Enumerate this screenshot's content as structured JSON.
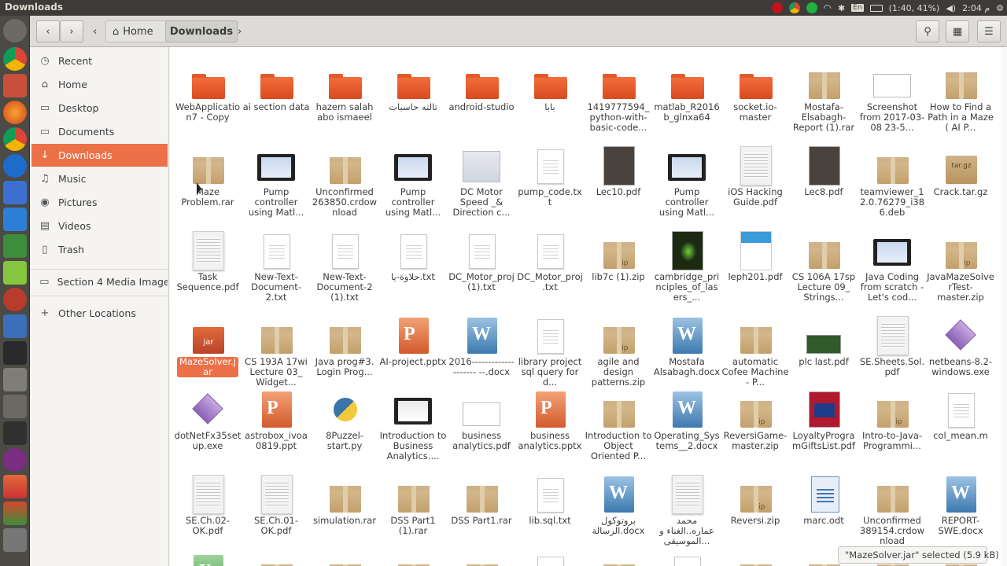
{
  "window_title": "Downloads",
  "tray": {
    "keyboard": "En",
    "battery": "(1:40, 41%)",
    "clock": "2:04 م"
  },
  "header": {
    "home_label": "Home",
    "current_label": "Downloads"
  },
  "sidebar": {
    "items": [
      {
        "label": "Recent",
        "icon": "clock-icon"
      },
      {
        "label": "Home",
        "icon": "home-icon"
      },
      {
        "label": "Desktop",
        "icon": "folder-icon"
      },
      {
        "label": "Documents",
        "icon": "folder-icon"
      },
      {
        "label": "Downloads",
        "icon": "download-icon"
      },
      {
        "label": "Music",
        "icon": "music-icon"
      },
      {
        "label": "Pictures",
        "icon": "camera-icon"
      },
      {
        "label": "Videos",
        "icon": "film-icon"
      },
      {
        "label": "Trash",
        "icon": "trash-icon"
      }
    ],
    "device": "Section 4 Media Image...",
    "other": "Other Locations"
  },
  "files": [
    [
      {
        "name": "WebApplication7 - Copy",
        "type": "folder"
      },
      {
        "name": "ai section data",
        "type": "folder"
      },
      {
        "name": "hazem salah abo ismaeel",
        "type": "folder"
      },
      {
        "name": "تالته حاسبات",
        "type": "folder"
      },
      {
        "name": "android-studio",
        "type": "folder"
      },
      {
        "name": "بابا",
        "type": "folder"
      },
      {
        "name": "1419777594_python-with-basic-code...",
        "type": "folder"
      },
      {
        "name": "matlab_R2016b_glnxa64",
        "type": "folder"
      },
      {
        "name": "socket.io-master",
        "type": "folder"
      },
      {
        "name": "Mostafa-Elsabagh-Report (1).rar",
        "type": "box"
      },
      {
        "name": "Screenshot from 2017-03-08 23-5...",
        "type": "img2"
      },
      {
        "name": "How to Find a Path in a Maze ( AI P...",
        "type": "box"
      }
    ],
    [
      {
        "name": "Maze Problem.rar",
        "type": "box"
      },
      {
        "name": "Pump controller using Matl...",
        "type": "vid"
      },
      {
        "name": "Unconfirmed 263850.crdownload",
        "type": "box"
      },
      {
        "name": "Pump controller using Matl...",
        "type": "vid"
      },
      {
        "name": "DC Motor Speed _& Direction c...",
        "type": "img"
      },
      {
        "name": "pump_code.txt",
        "type": "doc"
      },
      {
        "name": "Lec10.pdf",
        "type": "pdfdark"
      },
      {
        "name": "Pump controller using Matl...",
        "type": "vid"
      },
      {
        "name": "iOS Hacking Guide.pdf",
        "type": "pdf"
      },
      {
        "name": "Lec8.pdf",
        "type": "pdfdark"
      },
      {
        "name": "teamviewer_12.0.76279_i386.deb",
        "type": "box"
      },
      {
        "name": "Crack.tar.gz",
        "type": "tgz"
      }
    ],
    [
      {
        "name": "Task Sequence.pdf",
        "type": "pdf"
      },
      {
        "name": "New-Text-Document-2.txt",
        "type": "doc"
      },
      {
        "name": "New-Text-Document-2 (1).txt",
        "type": "doc"
      },
      {
        "name": "حلاوة-يا.txt",
        "type": "doc"
      },
      {
        "name": "DC_Motor_proj (1).txt",
        "type": "doc"
      },
      {
        "name": "DC_Motor_proj.txt",
        "type": "doc"
      },
      {
        "name": "lib7c (1).zip",
        "type": "zip"
      },
      {
        "name": "cambridge_principles_of_lasers_...",
        "type": "pdfgreen"
      },
      {
        "name": "leph201.pdf",
        "type": "pdfblue"
      },
      {
        "name": "CS 106A 17sp Lecture 09_ Strings...",
        "type": "box"
      },
      {
        "name": "Java Coding from scratch - Let's cod...",
        "type": "vid"
      },
      {
        "name": "JavaMazeSolverTest-master.zip",
        "type": "zip"
      }
    ],
    [
      {
        "name": "MazeSolver.jar",
        "type": "jar",
        "selected": true
      },
      {
        "name": "CS 193A 17wi Lecture 03_ Widget...",
        "type": "box"
      },
      {
        "name": "Java prog#3. Login Prog...",
        "type": "box"
      },
      {
        "name": "AI-project.pptx",
        "type": "ppt"
      },
      {
        "name": "2016-------------------- --.docx",
        "type": "word"
      },
      {
        "name": "library project sql query for d...",
        "type": "doc"
      },
      {
        "name": "agile and design patterns.zip",
        "type": "zip"
      },
      {
        "name": "Mostafa Alsabagh.docx",
        "type": "word"
      },
      {
        "name": "automatic Cofee Machine - P...",
        "type": "box"
      },
      {
        "name": "plc last.pdf",
        "type": "imgnote"
      },
      {
        "name": "SE.Sheets.Sol.pdf",
        "type": "pdf"
      },
      {
        "name": "netbeans-8.2-windows.exe",
        "type": "dia"
      }
    ],
    [
      {
        "name": "dotNetFx35setup.exe",
        "type": "dia"
      },
      {
        "name": "astrobox_ivoa0819.ppt",
        "type": "ppt"
      },
      {
        "name": "8Puzzel-start.py",
        "type": "py"
      },
      {
        "name": "Introduction to Business Analytics....",
        "type": "vidgray"
      },
      {
        "name": "business analytics.pdf",
        "type": "img2"
      },
      {
        "name": "business analytics.pptx",
        "type": "ppt"
      },
      {
        "name": "Introduction to Object Oriented P...",
        "type": "box"
      },
      {
        "name": "Operating_Systems__2.docx",
        "type": "word"
      },
      {
        "name": "ReversiGame-master.zip",
        "type": "zip"
      },
      {
        "name": "LoyaltyProgramGiftsList.pdf",
        "type": "pdfbook"
      },
      {
        "name": "Intro-to-Java-Programmi...",
        "type": "zip"
      },
      {
        "name": "col_mean.m",
        "type": "doc"
      }
    ],
    [
      {
        "name": "SE.Ch.02-OK.pdf",
        "type": "pdf"
      },
      {
        "name": "SE.Ch.01-OK.pdf",
        "type": "pdf"
      },
      {
        "name": "simulation.rar",
        "type": "box"
      },
      {
        "name": "DSS Part1 (1).rar",
        "type": "box"
      },
      {
        "name": "DSS Part1.rar",
        "type": "box"
      },
      {
        "name": "lib.sql.txt",
        "type": "doc"
      },
      {
        "name": "بروتوكول الرسالة.docx",
        "type": "word"
      },
      {
        "name": "محمد عماره..الغناء و الموسيقى...",
        "type": "pdf"
      },
      {
        "name": "Reversi.zip",
        "type": "zip"
      },
      {
        "name": "marc.odt",
        "type": "odt"
      },
      {
        "name": "Unconfirmed 389154.crdownload",
        "type": "box"
      },
      {
        "name": "REPORT-SWE.docx",
        "type": "word"
      }
    ]
  ],
  "status": "\"MazeSolver.jar\" selected (5.9 kB)",
  "colors": {
    "accent": "#ec7048",
    "topbar": "#3c3b37",
    "launcher": "#4b4a44"
  }
}
